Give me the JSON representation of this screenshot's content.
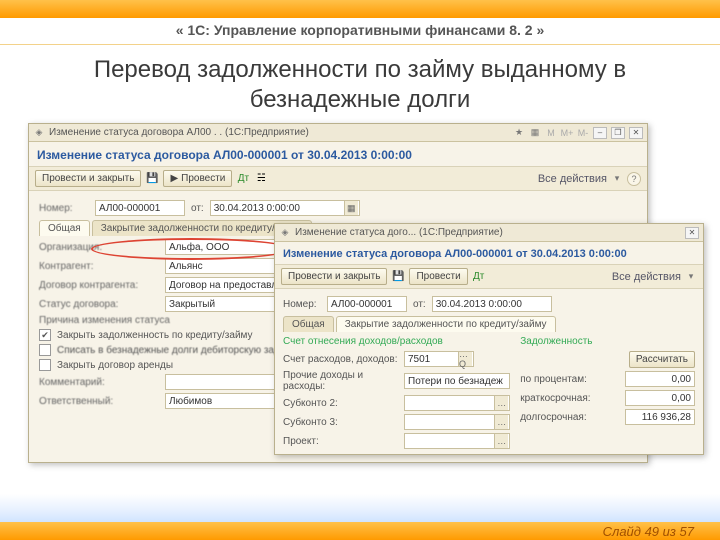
{
  "header": {
    "product": "« 1С: Управление корпоративными финансами 8. 2 »"
  },
  "slide": {
    "title": "Перевод задолженности по займу выданному в безнадежные долги"
  },
  "win1": {
    "titlebar": "Изменение статуса договора АЛ00 . .  (1С:Предприятие)",
    "heading": "Изменение статуса договора АЛ00-000001 от 30.04.2013 0:00:00",
    "btn_post_close": "Провести и закрыть",
    "btn_post": "Провести",
    "all_actions": "Все действия",
    "row_number_lbl": "Номер:",
    "row_number_val": "АЛ00-000001",
    "row_date_lbl": "от:",
    "row_date_val": "30.04.2013 0:00:00",
    "tab_general": "Общая",
    "tab_close": "Закрытие задолженности по кредиту/займу",
    "org_lbl": "Организация:",
    "org_val": "Альфа, ООО",
    "contr_lbl": "Контрагент:",
    "contr_val": "Альянс",
    "contract_lbl": "Договор контрагента:",
    "contract_val": "Договор на предоставление зай",
    "status_lbl": "Статус договора:",
    "status_val": "Закрытый",
    "reason_lbl": "Причина изменения статуса",
    "chk1": "Закрыть задолженность по кредиту/займу",
    "chk2": "Списать в безнадежные долги дебиторскую задолженность",
    "chk3": "Закрыть договор аренды",
    "comment_lbl": "Комментарий:",
    "responsible_lbl": "Ответственный:",
    "responsible_val": "Любимов"
  },
  "win2": {
    "titlebar": "Изменение статуса дого...   (1С:Предприятие)",
    "heading": "Изменение статуса договора АЛ00-000001 от 30.04.2013 0:00:00",
    "btn_post_close": "Провести и закрыть",
    "btn_post": "Провести",
    "all_actions": "Все действия",
    "row_number_lbl": "Номер:",
    "row_number_val": "АЛ00-000001",
    "row_date_lbl": "от:",
    "row_date_val": "30.04.2013 0:00:00",
    "tab_general": "Общая",
    "tab_close": "Закрытие задолженности по кредиту/займу",
    "left_head": "Счет отнесения доходов/расходов",
    "right_head": "Задолженность",
    "acc_lbl": "Счет расходов, доходов:",
    "acc_val": "7501",
    "other_lbl": "Прочие доходы и расходы:",
    "other_val": "Потери по безнадеж",
    "sub2_lbl": "Субконто 2:",
    "sub3_lbl": "Субконто 3:",
    "proj_lbl": "Проект:",
    "recalc": "Рассчитать",
    "r1_lbl": "по процентам:",
    "r1_val": "0,00",
    "r2_lbl": "краткосрочная:",
    "r2_val": "0,00",
    "r3_lbl": "долгосрочная:",
    "r3_val": "116 936,28"
  },
  "footer": {
    "slide": "Слайд 49 из 57"
  }
}
